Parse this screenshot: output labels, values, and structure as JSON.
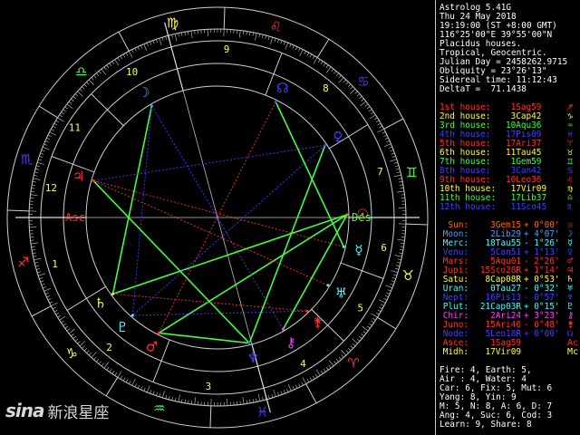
{
  "header": {
    "program": "Astrolog 5.41G",
    "date": "Thu 24 May 2018",
    "time": "19:19:00 (ST +8:00 GMT)",
    "location": "116°25'00\"E 39°55'00\"N",
    "house_system": "Placidus houses.",
    "zodiac": "Tropical, Geocentric.",
    "julian_day": "Julian Day = 2458262.9715",
    "obliquity": "Obliquity = 23°26'13\"",
    "sidereal_time": "Sidereal time: 11:12:43",
    "deltat": "DeltaT =  71.1438"
  },
  "houses": [
    {
      "label": "1st house:",
      "value": "1Sag59",
      "glyph": "♐",
      "color": "#ff3030"
    },
    {
      "label": "2nd house:",
      "value": "3Cap42",
      "glyph": "♑",
      "color": "#ffff40"
    },
    {
      "label": "3rd house:",
      "value": "10Aqu36",
      "glyph": "♒",
      "color": "#40ff40"
    },
    {
      "label": "4th house:",
      "value": "17Pis09",
      "glyph": "♓",
      "color": "#4040ff"
    },
    {
      "label": "5th house:",
      "value": "17Ari37",
      "glyph": "♈",
      "color": "#ff3030"
    },
    {
      "label": "6th house:",
      "value": "11Tau45",
      "glyph": "♉",
      "color": "#ffff40"
    },
    {
      "label": "7th house:",
      "value": "1Gem59",
      "glyph": "♊",
      "color": "#40ff40"
    },
    {
      "label": "8th house:",
      "value": "3Can42",
      "glyph": "♋",
      "color": "#4040ff"
    },
    {
      "label": "9th house:",
      "value": "10Leo36",
      "glyph": "♌",
      "color": "#ff3030"
    },
    {
      "label": "10th house:",
      "value": "17Vir09",
      "glyph": "♍",
      "color": "#ffff40"
    },
    {
      "label": "11th house:",
      "value": "17Lib37",
      "glyph": "♎",
      "color": "#40ff40"
    },
    {
      "label": "12th house:",
      "value": "11Sco45",
      "glyph": "♏",
      "color": "#4040ff"
    }
  ],
  "planets": [
    {
      "name": "Sun:",
      "pos": "3Gem15",
      "speed": "+ 0°00'",
      "glyph": "☉",
      "color": "#ff6a00"
    },
    {
      "name": "Moon:",
      "pos": "2Lib29",
      "speed": "+ 4°07'",
      "glyph": "☽",
      "color": "#4aa0ff"
    },
    {
      "name": "Merc:",
      "pos": "18Tau55",
      "speed": "- 1°26'",
      "glyph": "☿",
      "color": "#40ffff"
    },
    {
      "name": "Venu:",
      "pos": "5Can51",
      "speed": "+ 1°13'",
      "glyph": "♀",
      "color": "#4040ff"
    },
    {
      "name": "Mars:",
      "pos": "5Aqu01",
      "speed": "- 2°26'",
      "glyph": "♂",
      "color": "#ff3030"
    },
    {
      "name": "Jupi:",
      "pos": "15Sco28R",
      "speed": "+ 1°14'",
      "glyph": "♃",
      "color": "#ff3030"
    },
    {
      "name": "Satu:",
      "pos": "8Cap08R",
      "speed": "+ 0°53'",
      "glyph": "♄",
      "color": "#ffff40"
    },
    {
      "name": "Uran:",
      "pos": "0Tau27",
      "speed": "- 0°32'",
      "glyph": "♅",
      "color": "#40ffff"
    },
    {
      "name": "Nept:",
      "pos": "16Pis13",
      "speed": "- 0°57'",
      "glyph": "♆",
      "color": "#4040ff"
    },
    {
      "name": "Plut:",
      "pos": "21Cap03R",
      "speed": "+ 0°15'",
      "glyph": "♇",
      "color": "#40ffff"
    },
    {
      "name": "Chir:",
      "pos": "2Ari24",
      "speed": "+ 3°23'",
      "glyph": "⚷",
      "color": "#ff40ff"
    },
    {
      "name": "Juno:",
      "pos": "15Ari46",
      "speed": "- 0°48'",
      "glyph": "⚵",
      "color": "#ff3030"
    },
    {
      "name": "Node:",
      "pos": "5Leo18R",
      "speed": "+ 0°00'",
      "glyph": "☊",
      "color": "#4040ff"
    },
    {
      "name": "Asce:",
      "pos": "1Sag59",
      "speed": "",
      "glyph": "Ac",
      "color": "#ff3030"
    },
    {
      "name": "Midh:",
      "pos": "17Vir09",
      "speed": "",
      "glyph": "Mc",
      "color": "#ffff40"
    }
  ],
  "elements": [
    "Fire: 4, Earth: 5,",
    "Air : 4, Water: 4",
    "Car: 6, Fix: 5, Mut: 6",
    "Yang: 8, Yin: 9",
    "M: 5, N: 8, A: 6, D: 7",
    "Ang: 4, Suc: 6, Cod: 3",
    "Learn: 9, Share: 8"
  ],
  "watermark": {
    "logo": "sina",
    "text": "新浪星座"
  },
  "chart_labels": {
    "asc": "Asc",
    "des": "Des",
    "house_numbers": [
      "1",
      "2",
      "3",
      "4",
      "5",
      "6",
      "7",
      "8",
      "9",
      "10",
      "11",
      "12"
    ]
  },
  "colors": {
    "bg": "#000000",
    "ring": "#ffffff",
    "text": "#ffffff"
  }
}
